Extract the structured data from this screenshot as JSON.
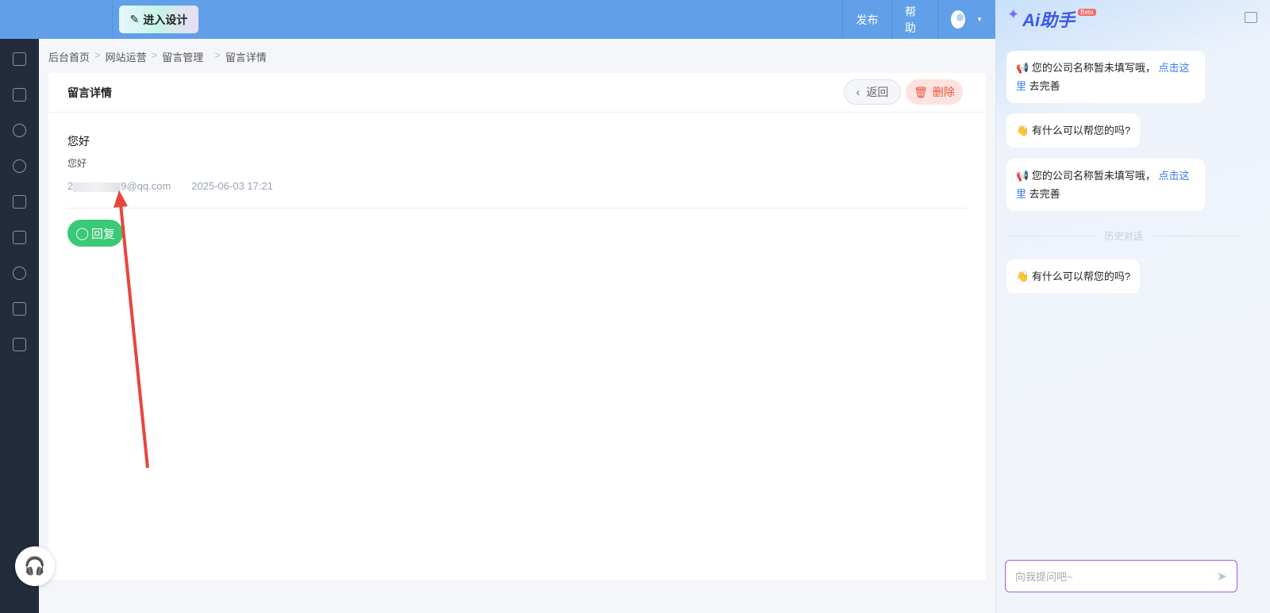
{
  "topbar": {
    "design_label": "进入设计",
    "publish_label": "发布",
    "help_label": "帮助"
  },
  "sidebar": {
    "items": [
      "home",
      "pages",
      "planet",
      "wechat",
      "list",
      "shop",
      "settings",
      "terminal",
      "trash"
    ]
  },
  "breadcrumb": [
    "后台首页",
    "网站运营",
    "留言管理",
    "留言详情"
  ],
  "card": {
    "title": "留言详情",
    "back_label": "返回",
    "delete_label": "删除",
    "message": {
      "title": "您好",
      "body": "您好",
      "email_prefix": "2",
      "email_suffix": "9@qq.com",
      "time": "2025-06-03 17:21"
    },
    "reply_label": "回复"
  },
  "ai": {
    "title": "Ai助手",
    "beta": "Beta",
    "messages": [
      {
        "text": "您的公司名称暂未填写哦，",
        "link": "点击这里",
        "after": "去完善"
      },
      {
        "text": "有什么可以帮您的吗?"
      },
      {
        "text": "您的公司名称暂未填写哦，",
        "link": "点击这里",
        "after": "去完善"
      }
    ],
    "history_label": "历史对话",
    "history_message": "有什么可以帮您的吗?",
    "input_placeholder": "向我提问吧~"
  },
  "colors": {
    "topbar": "#619fe8",
    "sidebar": "#232c3b",
    "reply": "#3ac976",
    "delete": "#e8553f",
    "link": "#3a7bf0"
  }
}
